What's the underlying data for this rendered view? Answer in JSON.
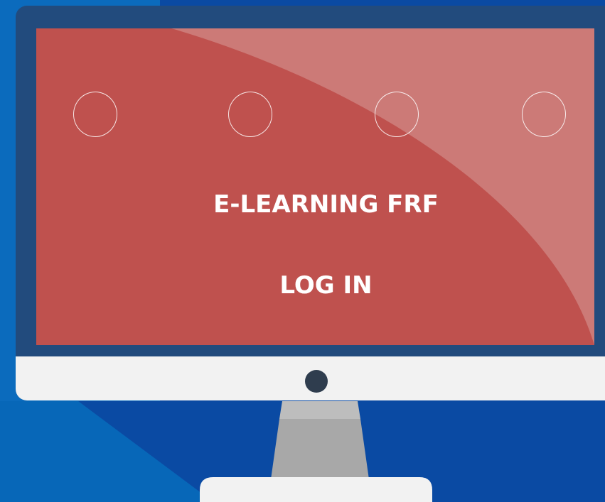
{
  "colors": {
    "background": "#0a4aa3",
    "background_highlight": "#0b6bbd",
    "monitor_bezel": "#224b7d",
    "monitor_chin": "#f2f2f2",
    "screen": "#bf514e",
    "screen_glare": "#cc7a77",
    "stand": "#a8a8a8",
    "camera": "#2f3d4e",
    "text": "#ffffff"
  },
  "screen": {
    "title": "E-LEARNING FRF",
    "login_label": "LOG IN"
  },
  "decor": {
    "ring_count": 4,
    "camera_icon": "camera-dot-icon"
  }
}
